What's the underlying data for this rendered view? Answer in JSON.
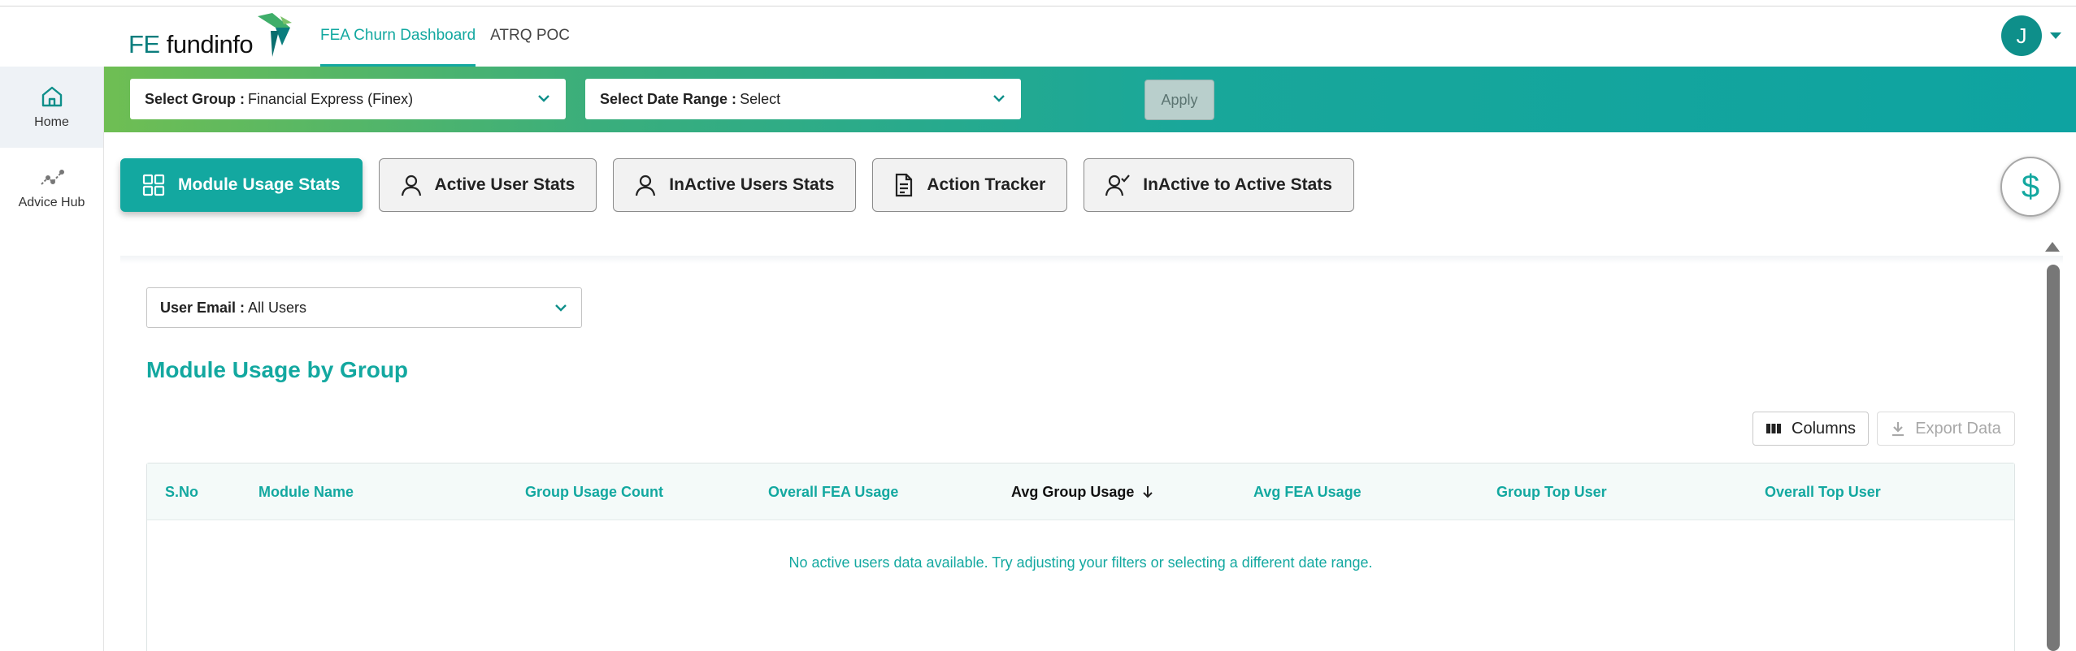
{
  "header": {
    "logo_text_prefix": "FE",
    "logo_text_main": "fundinfo",
    "nav": [
      {
        "label": "FEA Churn Dashboard",
        "active": true
      },
      {
        "label": "ATRQ POC",
        "active": false
      }
    ],
    "user_initial": "J"
  },
  "sidebar": {
    "items": [
      {
        "label": "Home",
        "icon": "home-icon",
        "active": true
      },
      {
        "label": "Advice Hub",
        "icon": "advice-hub-icon",
        "active": false
      }
    ]
  },
  "filters": {
    "group_label": "Select Group :",
    "group_value": "Financial Express (Finex)",
    "date_label": "Select Date Range :",
    "date_value": "Select",
    "apply_label": "Apply"
  },
  "tabs": [
    {
      "label": "Module Usage Stats",
      "icon": "grid-icon",
      "active": true
    },
    {
      "label": "Active User Stats",
      "icon": "user-icon",
      "active": false
    },
    {
      "label": "InActive Users Stats",
      "icon": "user-icon",
      "active": false
    },
    {
      "label": "Action Tracker",
      "icon": "document-icon",
      "active": false
    },
    {
      "label": "InActive to Active Stats",
      "icon": "user-check-icon",
      "active": false
    }
  ],
  "dollar_symbol": "$",
  "content": {
    "email_label": "User Email :",
    "email_value": "All Users",
    "section_title": "Module Usage by Group",
    "columns_label": "Columns",
    "export_label": "Export Data",
    "table": {
      "columns": [
        "S.No",
        "Module Name",
        "Group Usage Count",
        "Overall FEA Usage",
        "Avg Group Usage",
        "Avg FEA Usage",
        "Group Top User",
        "Overall Top User"
      ],
      "sorted_column": "Avg Group Usage",
      "empty_message": "No active users data available. Try adjusting your filters or selecting a different date range."
    }
  },
  "colors": {
    "accent": "#13a8a0",
    "gradient_start": "#6fbe53",
    "gradient_end": "#0ea3a1"
  }
}
